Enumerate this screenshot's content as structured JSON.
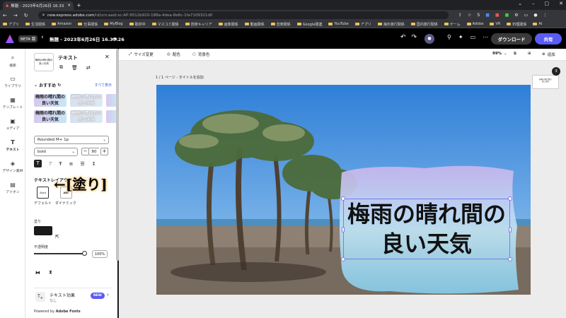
{
  "browser": {
    "tab_title": "無題 - 2023年6月26日 16.33.26",
    "url_host": "new.express.adobe.com",
    "url_path": "/id/urn:aaid:sc:AP:9512b920-188a-4dea-8e6c-1fa7109321d0",
    "bookmarks": [
      "アプリ",
      "生活関係",
      "Amazon",
      "仕事関係",
      "MyBlog",
      "取材中",
      "マスコミ関係",
      "技術キャリア",
      "画像関係",
      "動画関係",
      "音楽関係",
      "Google関連",
      "YouTube",
      "アプリ",
      "海外旅行関係",
      "国内旅行関係",
      "ゲーム",
      "Adobe",
      "VR",
      "料理関係",
      "AI"
    ]
  },
  "app": {
    "beta_label": "BETA 版",
    "doc_title": "無題 - 2023年6月26日 16.33.26",
    "download_label": "ダウンロード",
    "share_label": "共有"
  },
  "rail": [
    "検索",
    "ライブラリ",
    "テンプレート",
    "メディア",
    "テキスト",
    "デザイン素材",
    "アドオン"
  ],
  "panel": {
    "title": "テキスト",
    "thumb_text": "梅雨の晴れ間の良い天気",
    "recommended": "おすすめ",
    "see_all": "すべて表示",
    "presets": [
      {
        "line1": "梅雨の晴れ間の",
        "line2": "良い天気"
      },
      {
        "line1": "梅雨の晴れ間の",
        "line2": "良い天気"
      },
      {
        "line1": "梅雨の晴れ間の",
        "line2": "良い天気"
      },
      {
        "line1": "梅雨の晴れ間の",
        "line2": "良い天気"
      }
    ],
    "font_family": "Rounded M+ 1p",
    "font_weight": "bold",
    "font_size": "80",
    "layout_title": "テキストレイアウト",
    "layout_default_label": "デフォルト",
    "layout_dynamic_label": "ダイナミック",
    "layout_default_icon": "Abcd",
    "layout_dynamic_icon": "ABC",
    "fill_label": "塗り",
    "fill_color": "#1a1a1a",
    "opacity_label": "不透明度",
    "opacity_value": "100%",
    "effects_title": "テキスト効果",
    "effects_sub": "なし",
    "new_badge": "NEW",
    "powered_prefix": "Powered by",
    "powered_brand": "Adobe Fonts"
  },
  "annotation": "←[塗り]",
  "canvas": {
    "toolbar_resize": "サイズ変更",
    "toolbar_color": "配色",
    "toolbar_bg": "背景色",
    "zoom": "99%",
    "add_label": "追加",
    "page_label": "1 / 1 ページ - タイトルを追加",
    "page_count_badge": "3",
    "text_line1": "梅雨の晴れ間の",
    "text_line2": "良い天気"
  }
}
